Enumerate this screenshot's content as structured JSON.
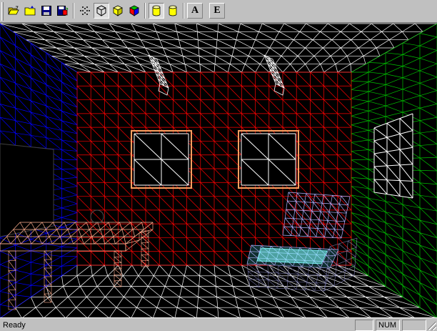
{
  "toolbar": {
    "buttons": [
      {
        "id": "open",
        "icon": "folder-open-icon"
      },
      {
        "id": "folder",
        "icon": "folder-icon"
      },
      {
        "id": "save",
        "icon": "floppy-disk-icon"
      },
      {
        "id": "export",
        "icon": "export-disk-icon"
      },
      {
        "id": "points",
        "icon": "point-cloud-icon",
        "pressed": false
      },
      {
        "id": "wireframe",
        "icon": "wireframe-cube-icon",
        "pressed": true
      },
      {
        "id": "flat",
        "icon": "flat-cube-icon",
        "pressed": false
      },
      {
        "id": "shaded",
        "icon": "shaded-cube-icon",
        "pressed": false
      },
      {
        "id": "cylinder-a",
        "icon": "cylinder-icon",
        "pressed": true
      },
      {
        "id": "cylinder-b",
        "icon": "cylinder-icon",
        "pressed": false
      },
      {
        "id": "text-a",
        "label": "A"
      },
      {
        "id": "text-e",
        "label": "E"
      }
    ]
  },
  "viewport": {
    "colors": {
      "left_wall": "#0000ff",
      "back_wall": "#ff0000",
      "right_wall": "#00c000",
      "ceiling_floor": "#ffffff",
      "window_frame": "#ffa060",
      "table": "#ffb090",
      "chair": "#b0b0ff",
      "cushion": "#80ffff"
    }
  },
  "statusbar": {
    "text": "Ready",
    "num_indicator": "NUM"
  }
}
